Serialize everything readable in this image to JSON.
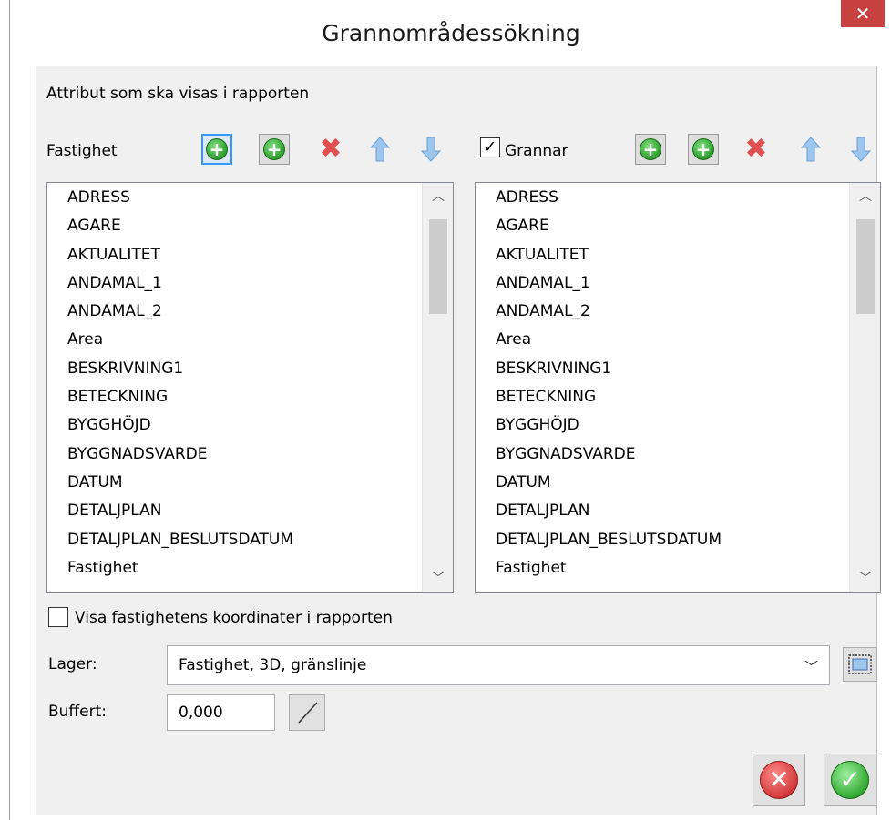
{
  "window": {
    "title": "Grannområdessökning",
    "close_glyph": "✕"
  },
  "report_label": "Attribut som ska visas i rapporten",
  "left_panel": {
    "label": "Fastighet",
    "items": [
      "ADRESS",
      "AGARE",
      "AKTUALITET",
      "ANDAMAL_1",
      "ANDAMAL_2",
      "Area",
      "BESKRIVNING1",
      "BETECKNING",
      "BYGGHÖJD",
      "BYGGNADSVARDE",
      "DATUM",
      "DETALJPLAN",
      "DETALJPLAN_BESLUTSDATUM",
      "Fastighet"
    ]
  },
  "right_panel": {
    "checkbox_checked": true,
    "label": "Grannar",
    "items": [
      "ADRESS",
      "AGARE",
      "AKTUALITET",
      "ANDAMAL_1",
      "ANDAMAL_2",
      "Area",
      "BESKRIVNING1",
      "BETECKNING",
      "BYGGHÖJD",
      "BYGGNADSVARDE",
      "DATUM",
      "DETALJPLAN",
      "DETALJPLAN_BESLUTSDATUM",
      "Fastighet"
    ]
  },
  "show_coords": {
    "checked": false,
    "label": "Visa fastighetens koordinater i rapporten"
  },
  "layer": {
    "label": "Lager:",
    "value": "Fastighet, 3D, gränslinje"
  },
  "buffer": {
    "label": "Buffert:",
    "value": "0,000"
  },
  "icons": {
    "add": "add-icon",
    "remove": "delete-icon",
    "up": "arrow-up-icon",
    "down": "arrow-down-icon",
    "cancel": "cancel-icon",
    "ok": "ok-icon"
  },
  "colors": {
    "accent_focus": "#3399ff",
    "close_red": "#c74141",
    "add_green": "#2e9e2e",
    "delete_red": "#e05050",
    "arrow_blue": "#7fb2e6",
    "cancel_red": "#d23a3a",
    "ok_green": "#34a934"
  }
}
